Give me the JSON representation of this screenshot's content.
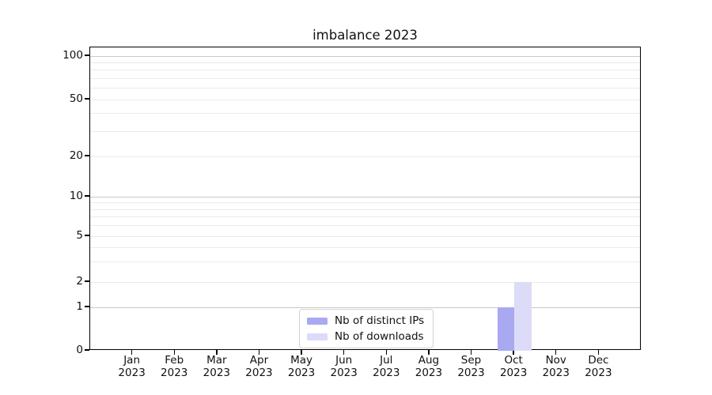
{
  "chart_data": {
    "type": "bar",
    "title": "imbalance 2023",
    "xlabel": "",
    "ylabel": "",
    "x_year": "2023",
    "categories": [
      "Jan",
      "Feb",
      "Mar",
      "Apr",
      "May",
      "Jun",
      "Jul",
      "Aug",
      "Sep",
      "Oct",
      "Nov",
      "Dec"
    ],
    "series": [
      {
        "name": "Nb of distinct IPs",
        "color": "#a9a9f1",
        "values": [
          0,
          0,
          0,
          0,
          0,
          0,
          0,
          0,
          0,
          1,
          0,
          0
        ]
      },
      {
        "name": "Nb of downloads",
        "color": "#dcdcf8",
        "values": [
          0,
          0,
          0,
          0,
          0,
          0,
          0,
          0,
          0,
          2,
          0,
          0
        ]
      }
    ],
    "yaxis": {
      "scale": "asinh-like (linear 0-1, log above)",
      "tick_values": [
        0,
        1,
        2,
        5,
        10,
        20,
        50,
        100
      ],
      "major_grid_values": [
        1,
        10,
        100
      ],
      "minor_grid_values": [
        2,
        3,
        4,
        5,
        6,
        7,
        8,
        9,
        20,
        30,
        40,
        50,
        60,
        70,
        80,
        90
      ],
      "ylim": [
        0,
        115
      ]
    },
    "grid": "horizontal",
    "legend": {
      "position": "inside lower-center",
      "entries": [
        "Nb of distinct IPs",
        "Nb of downloads"
      ]
    },
    "colors": {
      "grid_major": "#c8c8c8",
      "grid_minor": "#ebebeb",
      "spine": "#000000",
      "text": "#111111",
      "background": "#ffffff"
    }
  }
}
